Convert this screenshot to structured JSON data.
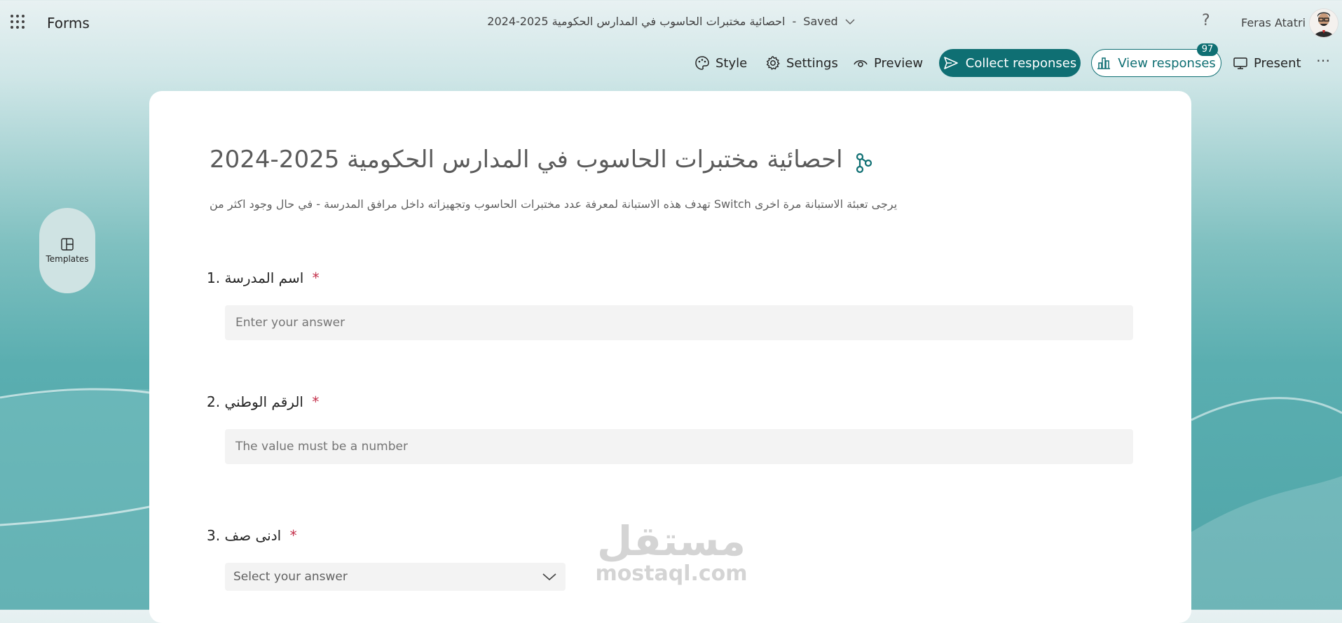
{
  "app": {
    "name": "Forms"
  },
  "document": {
    "title": "احصائية مختبرات الحاسوب في المدارس الحكومية    2025-2024",
    "status": "Saved"
  },
  "user": {
    "name": "Feras Atatri"
  },
  "toolbar": {
    "style": "Style",
    "settings": "Settings",
    "preview": "Preview",
    "collect": "Collect responses",
    "view_responses": "View responses",
    "responses_count": "97",
    "present": "Present"
  },
  "sidebar": {
    "templates": "Templates"
  },
  "form": {
    "title": "احصائية مختبرات الحاسوب في المدارس الحكومية    2025-2024",
    "description": "يرجى تعبئة الاستبانة مرة اخرى Switch تهدف هذه الاستبانة لمعرفة عدد مختبرات الحاسوب وتجهيزاته داخل مرافق المدرسة - في حال وجود اكثر من",
    "questions": [
      {
        "number": "1.",
        "label": "اسم المدرسة",
        "required": "*",
        "placeholder": "Enter your answer"
      },
      {
        "number": "2.",
        "label": "الرقم الوطني",
        "required": "*",
        "placeholder": "The value must be a number"
      },
      {
        "number": "3.",
        "label": "ادنى صف",
        "required": "*",
        "placeholder": "Select your answer"
      }
    ]
  },
  "watermark": {
    "arabic": "مستقل",
    "latin": "mostaql.com"
  },
  "colors": {
    "accent": "#0f6f73",
    "required": "#c4314b"
  }
}
